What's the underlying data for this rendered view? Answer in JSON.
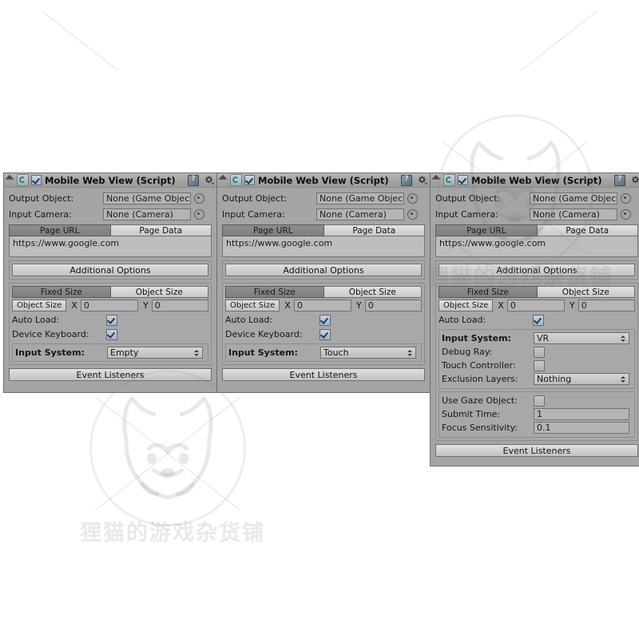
{
  "app": {
    "context": "Unity Inspector — Mobile Web View (Script) component, three configurations"
  },
  "watermark": {
    "text": "狸猫的游戏杂货铺",
    "icon": "raccoon-face-icon",
    "color": "#787878"
  },
  "icons": {
    "foldout": "foldout-triangle-icon",
    "script": "script-component-icon",
    "enable_checkbox": "component-enabled-checkbox",
    "help": "help-book-icon",
    "settings": "gear-settings-icon",
    "object_picker": "object-picker-dot-icon",
    "dropdown_arrows": "updown-arrows-icon"
  },
  "common": {
    "component_title": "Mobile Web View (Script)",
    "output_object_label": "Output Object:",
    "output_object_value": "None (Game Object",
    "input_camera_label": "Input Camera:",
    "input_camera_value": "None (Camera)",
    "tab_page_url": "Page URL",
    "tab_page_data": "Page Data",
    "page_url_value": "https://www.google.com",
    "additional_options_label": "Additional Options",
    "tab_fixed_size": "Fixed Size",
    "tab_object_size": "Object Size",
    "object_size_button": "Object Size",
    "axis_x": "X",
    "axis_y": "Y",
    "size_x_value": "0",
    "size_y_value": "0",
    "auto_load_label": "Auto Load:",
    "device_keyboard_label": "Device Keyboard:",
    "input_system_label": "Input System:",
    "event_listeners_label": "Event Listeners"
  },
  "panels": [
    {
      "id": "panel-empty",
      "title": "Mobile Web View (Script)",
      "enabled": true,
      "selected_size_tab": "Fixed Size",
      "selected_page_tab": "Page URL",
      "auto_load": true,
      "device_keyboard": true,
      "has_device_keyboard": true,
      "input_system_value": "Empty",
      "vr_options": null
    },
    {
      "id": "panel-touch",
      "title": "Mobile Web View (Script)",
      "enabled": true,
      "selected_size_tab": "Fixed Size",
      "selected_page_tab": "Page URL",
      "auto_load": true,
      "device_keyboard": true,
      "has_device_keyboard": true,
      "input_system_value": "Touch",
      "vr_options": null
    },
    {
      "id": "panel-vr",
      "title": "Mobile Web View (Script)",
      "enabled": true,
      "selected_size_tab": "Fixed Size",
      "selected_page_tab": "Page URL",
      "auto_load": true,
      "device_keyboard": false,
      "has_device_keyboard": false,
      "input_system_value": "VR",
      "vr_options": {
        "debug_ray_label": "Debug Ray:",
        "debug_ray_value": false,
        "touch_controller_label": "Touch Controller:",
        "touch_controller_value": false,
        "exclusion_layers_label": "Exclusion Layers:",
        "exclusion_layers_value": "Nothing",
        "use_gaze_object_label": "Use Gaze Object:",
        "use_gaze_object_value": false,
        "submit_time_label": "Submit Time:",
        "submit_time_value": "1",
        "focus_sensitivity_label": "Focus Sensitivity:",
        "focus_sensitivity_value": "0.1"
      }
    }
  ]
}
